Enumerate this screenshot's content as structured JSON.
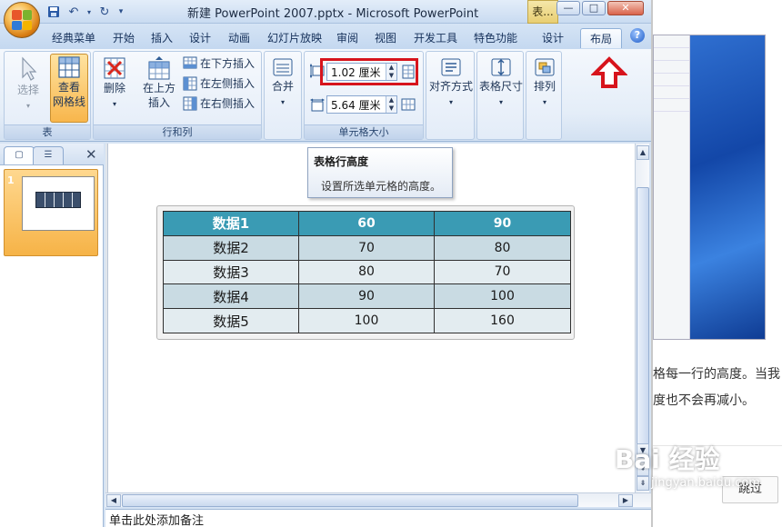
{
  "window": {
    "title": "新建 PowerPoint 2007.pptx - Microsoft PowerPoint",
    "context_tag": "表...",
    "controls": [
      "—",
      "□",
      "✕"
    ]
  },
  "tabs": [
    "经典菜单",
    "开始",
    "插入",
    "设计",
    "动画",
    "幻灯片放映",
    "审阅",
    "视图",
    "开发工具",
    "特色功能",
    "设计",
    "布局"
  ],
  "active_tab": "布局",
  "ribbon": {
    "group_table": {
      "label": "表",
      "select": "选择",
      "gridlines_line1": "查看",
      "gridlines_line2": "网格线"
    },
    "group_rows_cols": {
      "label": "行和列",
      "delete": "删除",
      "insert_above_line1": "在上方",
      "insert_above_line2": "插入",
      "insert_below": "在下方插入",
      "insert_left": "在左侧插入",
      "insert_right": "在右侧插入"
    },
    "merge": "合并",
    "group_cell_size": {
      "label": "单元格大小",
      "row_height": "1.02 厘米",
      "col_width": "5.64 厘米"
    },
    "align": "对齐方式",
    "table_size": "表格尺寸",
    "arrange": "排列"
  },
  "tooltip": {
    "title": "表格行高度",
    "description": "设置所选单元格的高度。"
  },
  "slide_pane": {
    "slide_number": "1"
  },
  "table": {
    "rows": [
      [
        "数据1",
        "60",
        "90"
      ],
      [
        "数据2",
        "70",
        "80"
      ],
      [
        "数据3",
        "80",
        "70"
      ],
      [
        "数据4",
        "90",
        "100"
      ],
      [
        "数据5",
        "100",
        "160"
      ]
    ]
  },
  "notes_placeholder": "单击此处添加备注",
  "browser": {
    "article_line1": "格每一行的高度。当我",
    "article_line2": "度也不会再减小。",
    "skip_button": "跳过"
  },
  "watermark": {
    "brand": "Bai 经验",
    "url": "jingyan.baidu.com"
  },
  "colors": {
    "header_fill": "#3a9bb4",
    "band_odd": "#c9dbe3",
    "band_even": "#e3ecf0",
    "highlight": "#d7141c"
  }
}
